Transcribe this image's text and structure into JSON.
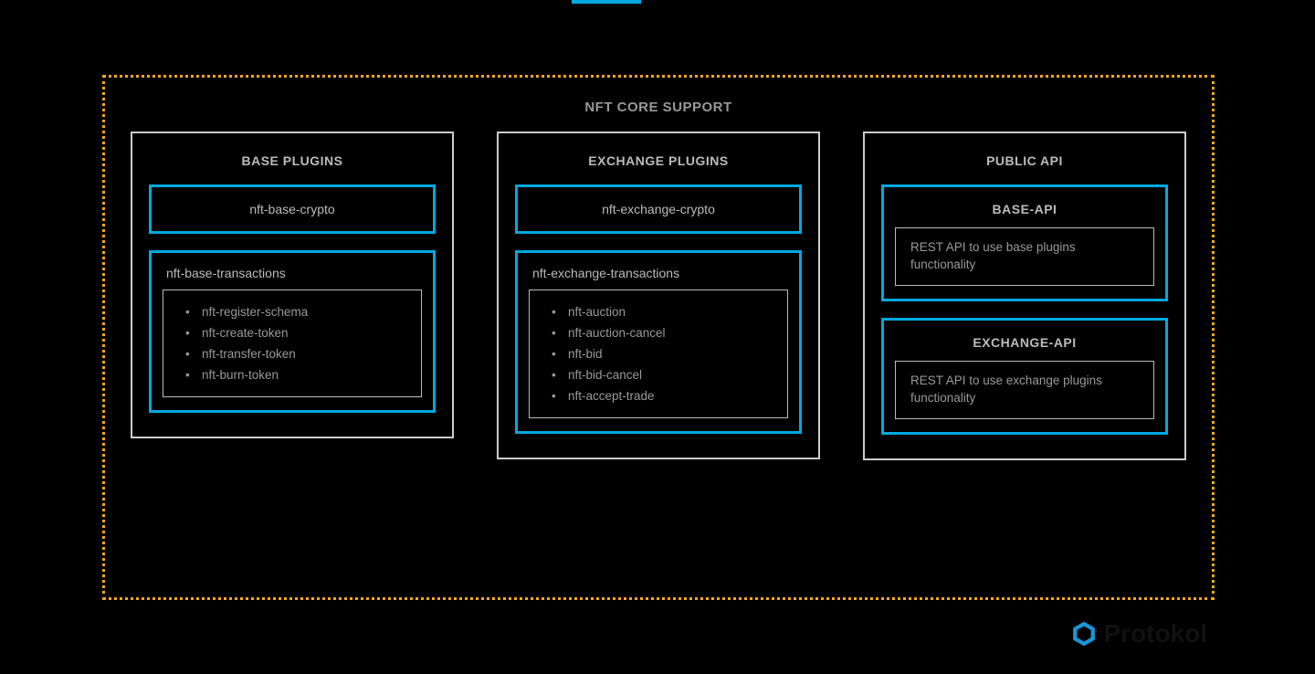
{
  "diagram": {
    "title": "NFT CORE SUPPORT",
    "columns": {
      "base": {
        "title": "BASE PLUGINS",
        "crypto": "nft-base-crypto",
        "transactions_title": "nft-base-transactions",
        "transactions": {
          "0": "nft-register-schema",
          "1": "nft-create-token",
          "2": "nft-transfer-token",
          "3": "nft-burn-token"
        }
      },
      "exchange": {
        "title": "EXCHANGE PLUGINS",
        "crypto": "nft-exchange-crypto",
        "transactions_title": "nft-exchange-transactions",
        "transactions": {
          "0": "nft-auction",
          "1": "nft-auction-cancel",
          "2": "nft-bid",
          "3": "nft-bid-cancel",
          "4": "nft-accept-trade"
        }
      },
      "api": {
        "title": "PUBLIC API",
        "base_api_title": "BASE-API",
        "base_api_desc": "REST API to use base plugins functionality",
        "exchange_api_title": "EXCHANGE-API",
        "exchange_api_desc": "REST API to use exchange plugins functionality"
      }
    }
  },
  "logo": {
    "text": "Protokol"
  }
}
